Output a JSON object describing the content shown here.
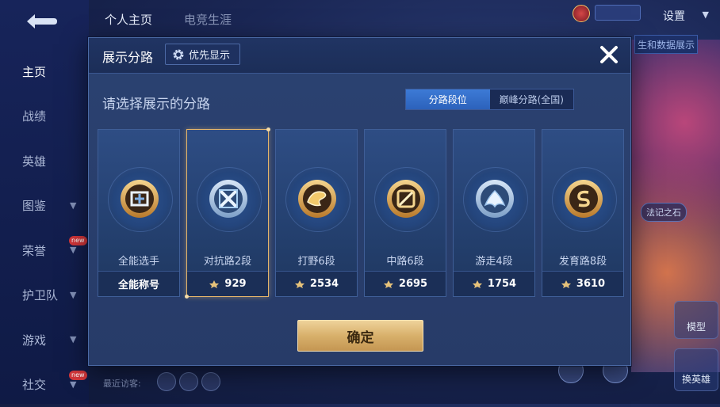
{
  "background": {
    "top_tabs": [
      "个人主页",
      "电竞生涯"
    ],
    "settings_label": "设置",
    "side_nav": [
      {
        "label": "主页",
        "active": true,
        "chevron": false,
        "new": false
      },
      {
        "label": "战绩",
        "active": false,
        "chevron": false,
        "new": false
      },
      {
        "label": "英雄",
        "active": false,
        "chevron": false,
        "new": false
      },
      {
        "label": "图鉴",
        "active": false,
        "chevron": true,
        "new": false
      },
      {
        "label": "荣誉",
        "active": false,
        "chevron": true,
        "new": true
      },
      {
        "label": "护卫队",
        "active": false,
        "chevron": true,
        "new": false
      },
      {
        "label": "游戏",
        "active": false,
        "chevron": true,
        "new": false
      },
      {
        "label": "社交",
        "active": false,
        "chevron": true,
        "new": true
      }
    ],
    "new_badge_text": "new",
    "recent_visitors_label": "最近访客:",
    "right_tab_label": "生和数据展示",
    "scene_tag_label": "法记之石",
    "model_label": "模型",
    "swap_hero_label": "换英雄"
  },
  "modal": {
    "title": "展示分路",
    "priority_label": "优先显示",
    "subtitle": "请选择展示的分路",
    "toggle": {
      "left": "分路段位",
      "right": "巅峰分路(全国)",
      "selected": "left"
    },
    "cards": [
      {
        "name": "全能选手",
        "footer": "全能称号",
        "has_score_icon": false,
        "selected": false,
        "emblem": "all-round-emblem-icon"
      },
      {
        "name": "对抗路2段",
        "footer": "929",
        "has_score_icon": true,
        "selected": true,
        "emblem": "clash-lane-emblem-icon"
      },
      {
        "name": "打野6段",
        "footer": "2534",
        "has_score_icon": true,
        "selected": false,
        "emblem": "jungle-emblem-icon"
      },
      {
        "name": "中路6段",
        "footer": "2695",
        "has_score_icon": true,
        "selected": false,
        "emblem": "mid-lane-emblem-icon"
      },
      {
        "name": "游走4段",
        "footer": "1754",
        "has_score_icon": true,
        "selected": false,
        "emblem": "roam-emblem-icon"
      },
      {
        "name": "发育路8段",
        "footer": "3610",
        "has_score_icon": true,
        "selected": false,
        "emblem": "farm-lane-emblem-icon"
      }
    ],
    "confirm_label": "确定"
  },
  "colors": {
    "accent_gold": "#e4b56b",
    "toggle_active": "#3d7ad6",
    "modal_bg": "#2b4271"
  }
}
